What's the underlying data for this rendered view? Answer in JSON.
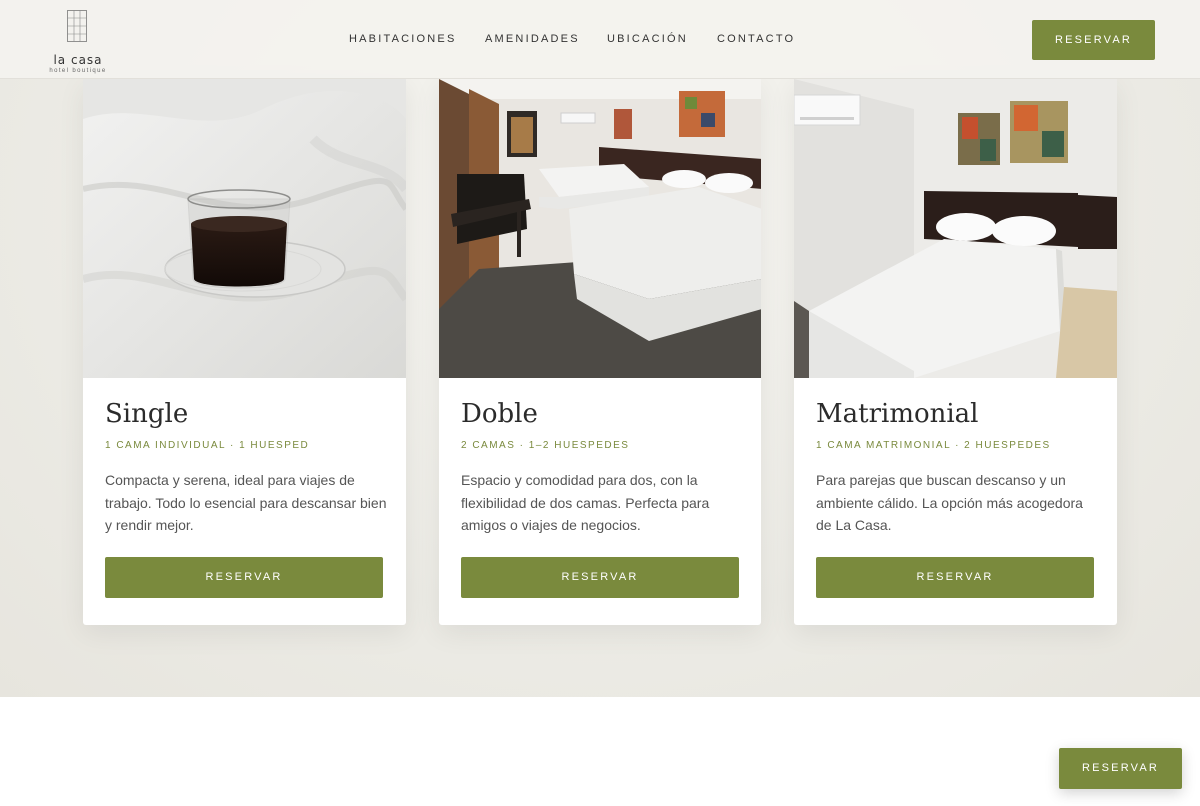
{
  "brand": {
    "name": "la casa",
    "tagline": "hotel boutique",
    "logo_icon": "building-grid-icon"
  },
  "nav": {
    "items": [
      "HABITACIONES",
      "AMENIDADES",
      "UBICACIÓN",
      "CONTACTO"
    ],
    "cta_label": "RESERVAR"
  },
  "colors": {
    "accent": "#7a8a3d",
    "background": "#efede7",
    "card": "#ffffff",
    "heading": "#2b2b2b"
  },
  "rooms": [
    {
      "title": "Single",
      "meta": "1 CAMA INDIVIDUAL · 1 HUESPED",
      "description": "Compacta y serena, ideal para viajes de trabajo. Todo lo esencial para descansar bien y rendir mejor.",
      "button_label": "RESERVAR",
      "image": "coffee-cup-on-bed-photo"
    },
    {
      "title": "Doble",
      "meta": "2 CAMAS · 1–2 HUESPEDES",
      "description": "Espacio y comodidad para dos, con la flexibilidad de dos camas. Perfecta para amigos o viajes de negocios.",
      "button_label": "RESERVAR",
      "image": "twin-beds-room-photo"
    },
    {
      "title": "Matrimonial",
      "meta": "1 CAMA MATRIMONIAL · 2 HUESPEDES",
      "description": "Para parejas que buscan descanso y un ambiente cálido. La opción más acogedora de La Casa.",
      "button_label": "RESERVAR",
      "image": "double-bed-room-photo"
    }
  ],
  "floating_cta": {
    "label": "RESERVAR"
  }
}
